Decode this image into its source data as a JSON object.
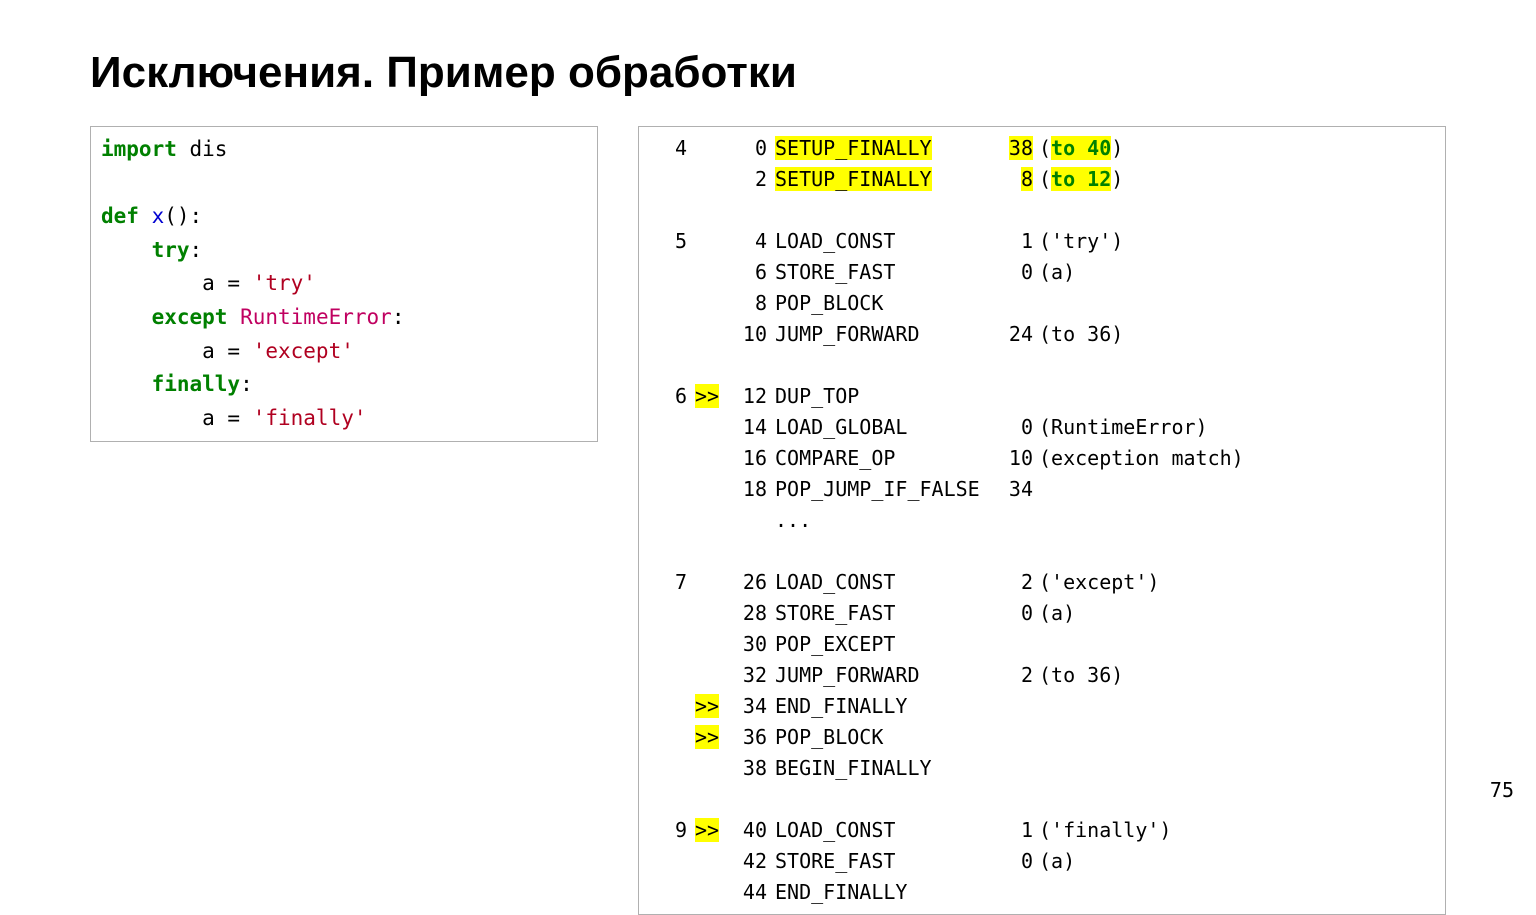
{
  "title": "Исключения. Пример обработки",
  "page_number": "75",
  "source": {
    "lines": [
      [
        [
          "kw",
          "import"
        ],
        [
          "p",
          " dis"
        ]
      ],
      "",
      [
        [
          "kw",
          "def"
        ],
        [
          "p",
          " "
        ],
        [
          "name",
          "x"
        ],
        [
          "p",
          "():"
        ]
      ],
      [
        [
          "p",
          "    "
        ],
        [
          "kw",
          "try"
        ],
        [
          "p",
          ":"
        ]
      ],
      [
        [
          "p",
          "        a = "
        ],
        [
          "str",
          "'try'"
        ]
      ],
      [
        [
          "p",
          "    "
        ],
        [
          "kw",
          "except"
        ],
        [
          "p",
          " "
        ],
        [
          "err",
          "RuntimeError"
        ],
        [
          "p",
          ":"
        ]
      ],
      [
        [
          "p",
          "        a = "
        ],
        [
          "str",
          "'except'"
        ]
      ],
      [
        [
          "p",
          "    "
        ],
        [
          "kw",
          "finally"
        ],
        [
          "p",
          ":"
        ]
      ],
      [
        [
          "p",
          "        a = "
        ],
        [
          "str",
          "'finally'"
        ]
      ]
    ]
  },
  "dis": {
    "rows": [
      {
        "ln": "4",
        "mk": "",
        "off": "0",
        "op": "SETUP_FINALLY",
        "op_hl": true,
        "arg": "38",
        "arg_hl": true,
        "extra": "(to 40)",
        "extra_hl": "to 40"
      },
      {
        "ln": "",
        "mk": "",
        "off": "2",
        "op": "SETUP_FINALLY",
        "op_hl": true,
        "arg": "8",
        "arg_hl": true,
        "extra": "(to 12)",
        "extra_hl": "to 12"
      },
      "blank",
      {
        "ln": "5",
        "mk": "",
        "off": "4",
        "op": "LOAD_CONST",
        "arg": "1",
        "extra": "('try')"
      },
      {
        "ln": "",
        "mk": "",
        "off": "6",
        "op": "STORE_FAST",
        "arg": "0",
        "extra": "(a)"
      },
      {
        "ln": "",
        "mk": "",
        "off": "8",
        "op": "POP_BLOCK",
        "arg": "",
        "extra": ""
      },
      {
        "ln": "",
        "mk": "",
        "off": "10",
        "op": "JUMP_FORWARD",
        "arg": "24",
        "extra": "(to 36)"
      },
      "blank",
      {
        "ln": "6",
        "mk": ">>",
        "mk_hl": true,
        "off": "12",
        "op": "DUP_TOP",
        "arg": "",
        "extra": ""
      },
      {
        "ln": "",
        "mk": "",
        "off": "14",
        "op": "LOAD_GLOBAL",
        "arg": "0",
        "extra": "(RuntimeError)"
      },
      {
        "ln": "",
        "mk": "",
        "off": "16",
        "op": "COMPARE_OP",
        "arg": "10",
        "extra": "(exception match)"
      },
      {
        "ln": "",
        "mk": "",
        "off": "18",
        "op": "POP_JUMP_IF_FALSE",
        "arg": "34",
        "extra": ""
      },
      {
        "ln": "",
        "mk": "",
        "off": "",
        "op": "...",
        "arg": "",
        "extra": ""
      },
      "blank",
      {
        "ln": "7",
        "mk": "",
        "off": "26",
        "op": "LOAD_CONST",
        "arg": "2",
        "extra": "('except')"
      },
      {
        "ln": "",
        "mk": "",
        "off": "28",
        "op": "STORE_FAST",
        "arg": "0",
        "extra": "(a)"
      },
      {
        "ln": "",
        "mk": "",
        "off": "30",
        "op": "POP_EXCEPT",
        "arg": "",
        "extra": ""
      },
      {
        "ln": "",
        "mk": "",
        "off": "32",
        "op": "JUMP_FORWARD",
        "arg": "2",
        "extra": "(to 36)"
      },
      {
        "ln": "",
        "mk": ">>",
        "mk_hl": true,
        "off": "34",
        "op": "END_FINALLY",
        "arg": "",
        "extra": ""
      },
      {
        "ln": "",
        "mk": ">>",
        "mk_hl": true,
        "off": "36",
        "op": "POP_BLOCK",
        "arg": "",
        "extra": ""
      },
      {
        "ln": "",
        "mk": "",
        "off": "38",
        "op": "BEGIN_FINALLY",
        "arg": "",
        "extra": ""
      },
      "blank",
      {
        "ln": "9",
        "mk": ">>",
        "mk_hl": true,
        "off": "40",
        "op": "LOAD_CONST",
        "arg": "1",
        "extra": "('finally')"
      },
      {
        "ln": "",
        "mk": "",
        "off": "42",
        "op": "STORE_FAST",
        "arg": "0",
        "extra": "(a)"
      },
      {
        "ln": "",
        "mk": "",
        "off": "44",
        "op": "END_FINALLY",
        "arg": "",
        "extra": ""
      }
    ]
  }
}
